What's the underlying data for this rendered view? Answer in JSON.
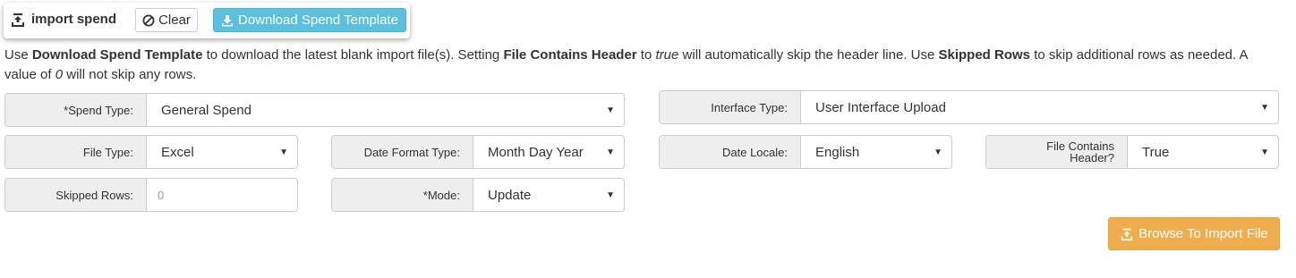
{
  "header": {
    "icon": "upload-tray-icon",
    "title": "import spend",
    "clear_icon": "ban-icon",
    "clear_label": "Clear",
    "download_icon": "download-icon",
    "download_label": "Download Spend Template"
  },
  "description": {
    "p1": "Use ",
    "b1": "Download Spend Template",
    "p2": " to download the latest blank import file(s). Setting ",
    "b2": "File Contains Header",
    "p3": " to ",
    "i1": "true",
    "p4": " will automatically skip the header line. Use ",
    "b3": "Skipped Rows",
    "p5": " to skip additional rows as needed. A value of ",
    "i2": "0",
    "p6": " will not skip any rows."
  },
  "form": {
    "spend_type": {
      "label": "*Spend Type:",
      "value": "General Spend"
    },
    "interface_type": {
      "label": "Interface Type:",
      "value": "User Interface Upload"
    },
    "file_type": {
      "label": "File Type:",
      "value": "Excel"
    },
    "date_format_type": {
      "label": "Date Format Type:",
      "value": "Month Day Year"
    },
    "date_locale": {
      "label": "Date Locale:",
      "value": "English"
    },
    "file_contains_header": {
      "label": "File Contains Header?",
      "value": "True"
    },
    "skipped_rows": {
      "label": "Skipped Rows:",
      "placeholder": "0"
    },
    "mode": {
      "label": "*Mode:",
      "value": "Update"
    }
  },
  "browse": {
    "icon": "upload-tray-icon",
    "label": "Browse To Import File"
  },
  "caret_glyph": "▼",
  "colors": {
    "info_button": "#5bc0de",
    "warning_button": "#f0ad4e",
    "label_bg": "#eeeeee",
    "border": "#cccccc"
  }
}
